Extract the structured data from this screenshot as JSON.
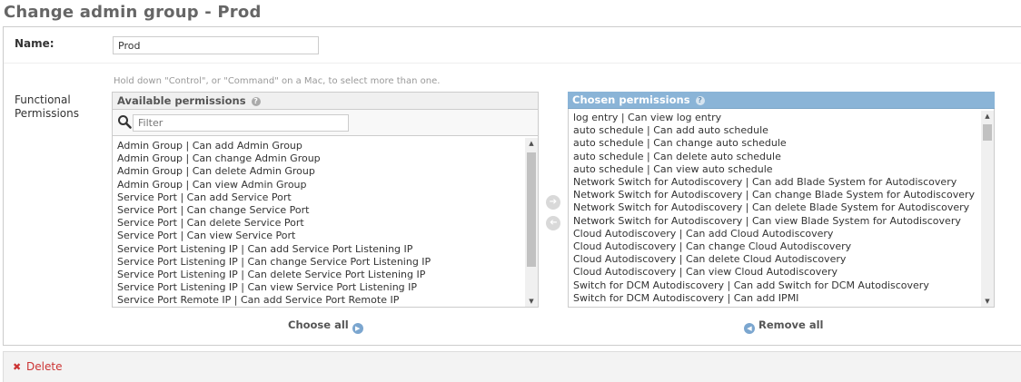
{
  "page": {
    "title": "Change admin group - Prod"
  },
  "form": {
    "name_label": "Name:",
    "name_value": "Prod",
    "help_text": "Hold down \"Control\", or \"Command\" on a Mac, to select more than one.",
    "perm_label_line1": "Functional",
    "perm_label_line2": "Permissions"
  },
  "available": {
    "title": "Available permissions",
    "filter_placeholder": "Filter",
    "items": [
      "Admin Group | Can add Admin Group",
      "Admin Group | Can change Admin Group",
      "Admin Group | Can delete Admin Group",
      "Admin Group | Can view Admin Group",
      "Service Port | Can add Service Port",
      "Service Port | Can change Service Port",
      "Service Port | Can delete Service Port",
      "Service Port | Can view Service Port",
      "Service Port Listening IP | Can add Service Port Listening IP",
      "Service Port Listening IP | Can change Service Port Listening IP",
      "Service Port Listening IP | Can delete Service Port Listening IP",
      "Service Port Listening IP | Can view Service Port Listening IP",
      "Service Port Remote IP | Can add Service Port Remote IP"
    ],
    "choose_all_label": "Choose all"
  },
  "chosen": {
    "title": "Chosen permissions",
    "items": [
      "log entry | Can view log entry",
      "auto schedule | Can add auto schedule",
      "auto schedule | Can change auto schedule",
      "auto schedule | Can delete auto schedule",
      "auto schedule | Can view auto schedule",
      "Network Switch for Autodiscovery | Can add Blade System for Autodiscovery",
      "Network Switch for Autodiscovery | Can change Blade System for Autodiscovery",
      "Network Switch for Autodiscovery | Can delete Blade System for Autodiscovery",
      "Network Switch for Autodiscovery | Can view Blade System for Autodiscovery",
      "Cloud Autodiscovery | Can add Cloud Autodiscovery",
      "Cloud Autodiscovery | Can change Cloud Autodiscovery",
      "Cloud Autodiscovery | Can delete Cloud Autodiscovery",
      "Cloud Autodiscovery | Can view Cloud Autodiscovery",
      "Switch for DCM Autodiscovery | Can add Switch for DCM Autodiscovery",
      "Switch for DCM Autodiscovery | Can add IPMI"
    ],
    "remove_all_label": "Remove all"
  },
  "footer": {
    "delete_label": "Delete"
  },
  "colors": {
    "chosen_header": "#8ab4d7",
    "delete_red": "#cc3333"
  },
  "icons": {
    "help": "question-circle-icon",
    "search": "magnifier-icon",
    "add": "arrow-right-circle-icon",
    "remove": "arrow-left-circle-icon",
    "delete": "x-icon"
  }
}
